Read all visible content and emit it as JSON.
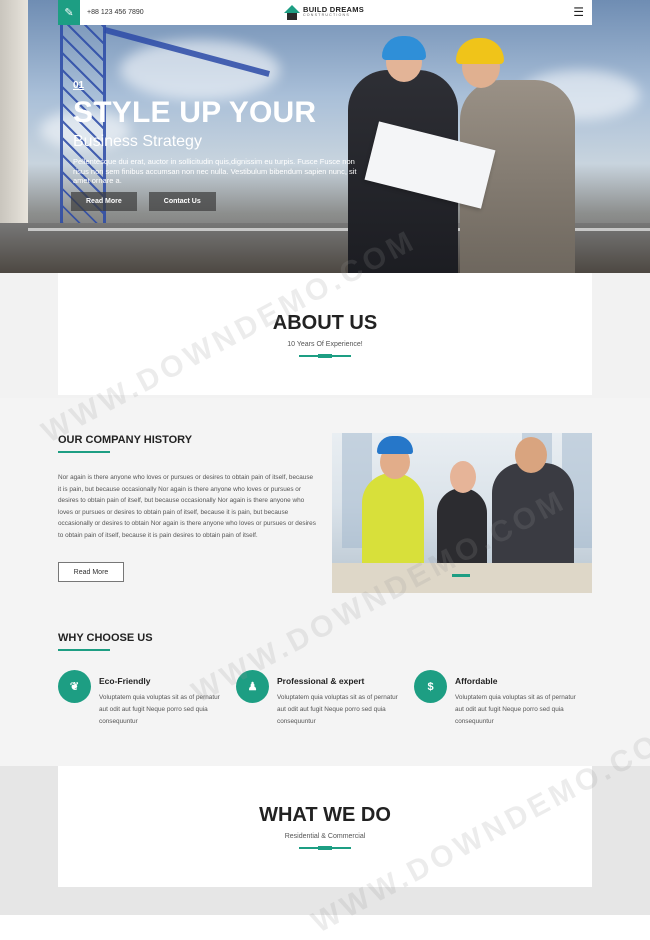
{
  "topbar": {
    "phone": "+88 123 456 7890",
    "logo_name": "BUILD DREAMS",
    "logo_sub": "CONSTRUCTIONS",
    "icons": [
      "edit-icon",
      "logo-house-icon",
      "hamburger-menu-icon"
    ]
  },
  "hero": {
    "slide_number": "01",
    "title": "STYLE UP YOUR",
    "subtitle": "Business Strategy",
    "paragraph": "Pellentesque dui erat, auctor in sollicitudin quis,dignissim eu turpis. Fusce Fusce non risus non sem finibus accumsan non nec nulla. Vestibulum bibendum sapien nunc, sit amet ornare a.",
    "buttons": [
      "Read More",
      "Contact Us"
    ]
  },
  "about": {
    "title": "ABOUT US",
    "subtitle": "10 Years Of Experience!"
  },
  "history": {
    "title": "OUR COMPANY HISTORY",
    "paragraph": "Nor again is there anyone who loves or pursues or desires to obtain pain of itself, because it is pain, but because occasionally Nor again is there anyone who loves or pursues or desires to obtain pain of itself, but because occasionally Nor again is there anyone who loves or pursues or desires to obtain pain of itself, because it is pain, but because occasionally or desires to obtain Nor again is there anyone who loves or pursues or desires to obtain pain of itself, because it is pain desires to obtain pain of itself.",
    "button": "Read More"
  },
  "why": {
    "title": "WHY CHOOSE US",
    "features": [
      {
        "icon": "leaf-icon",
        "glyph": "❦",
        "title": "Eco-Friendly",
        "text": "Voluptatem quia voluptas sit as of pernatur aut odit aut fugit Neque porro sed quia consequuntur"
      },
      {
        "icon": "person-icon",
        "glyph": "♟",
        "title": "Professional & expert",
        "text": "Voluptatem quia voluptas sit as of pernatur aut odit aut fugit Neque porro sed quia consequuntur"
      },
      {
        "icon": "dollar-icon",
        "glyph": "$",
        "title": "Affordable",
        "text": "Voluptatem quia voluptas sit as of pernatur aut odit aut fugit Neque porro sed quia consequuntur"
      }
    ]
  },
  "what": {
    "title": "WHAT WE DO",
    "subtitle": "Residential & Commercial"
  },
  "watermark": "WWW.DOWNDEMO.COM",
  "colors": {
    "accent": "#1d9e83",
    "dark": "#222222",
    "band": "#f4f4f4"
  }
}
